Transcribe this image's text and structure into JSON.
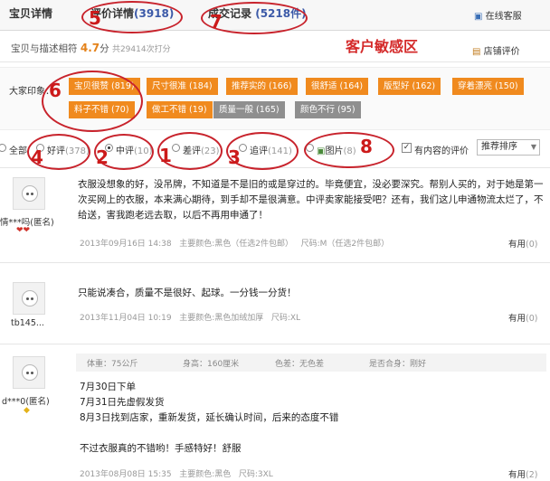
{
  "tabs": {
    "desc": "宝贝详情",
    "reviews_label": "评价详情",
    "reviews_count": "(3918)",
    "records_label": "成交记录",
    "records_count": "(5218件)",
    "service": "在线客服"
  },
  "rating": {
    "label": "宝贝与描述相符",
    "score": "4.7",
    "unit": "分",
    "total": "共29414次打分",
    "shop_rating": "店铺评价"
  },
  "sensitive_zone": "客户敏感区",
  "impressions": {
    "label": "大家印象：",
    "tags": [
      {
        "text": "宝贝很赞 (819)",
        "tone": "orange"
      },
      {
        "text": "尺寸很准 (184)",
        "tone": "orange"
      },
      {
        "text": "推荐实的 (166)",
        "tone": "orange"
      },
      {
        "text": "很舒适 (164)",
        "tone": "orange"
      },
      {
        "text": "版型好 (162)",
        "tone": "orange"
      },
      {
        "text": "穿着漂亮 (150)",
        "tone": "orange"
      },
      {
        "text": "料子不错 (70)",
        "tone": "orange"
      },
      {
        "text": "做工不错 (19)",
        "tone": "orange"
      },
      {
        "text": "质量一般 (165)",
        "tone": "gray"
      },
      {
        "text": "颜色不行 (95)",
        "tone": "gray"
      }
    ]
  },
  "filters": {
    "all": "全部",
    "good": "好评",
    "good_count": "(378)",
    "mid": "中评",
    "mid_count": "(10)",
    "bad": "差评",
    "bad_count": "(23)",
    "append": "追评",
    "append_count": "(141)",
    "pic": "图片",
    "pic_count": "(8)",
    "has_content": "有内容的评价",
    "sort": "推荐排序"
  },
  "annotations": {
    "a1": "1",
    "a2": "2",
    "a3": "3",
    "a4": "4",
    "a5": "5",
    "a6": "6",
    "a7": "7",
    "a8": "8"
  },
  "reviews": [
    {
      "user": "情***吗(匿名)",
      "text": "衣服没想象的好，没吊牌，不知道是不是旧的或是穿过的。毕竟便宜，没必要深究。帮别人买的，对于她是第一次买网上的衣服，本来满心期待，到手却不是很满意。中评卖家能接受吧？还有，我们这儿申通物流太烂了，不给送，害我跑老远去取，以后不再用申通了！",
      "date": "2013年09月16日 14:38",
      "color": "主要颜色:黑色（任选2件包邮）",
      "size": "尺码:M（任选2件包邮）",
      "useful": "有用",
      "useful_count": "(0)"
    },
    {
      "user": "tb145...",
      "text": "只能说凑合，质量不是很好、起球。一分钱一分货！",
      "date": "2013年11月04日 10:19",
      "color": "主要颜色:黑色加绒加厚",
      "size": "尺码:XL",
      "useful": "有用",
      "useful_count": "(0)"
    },
    {
      "user": "d***0(匿名)",
      "body": {
        "weight": "体重：75公斤",
        "height": "身高：160厘米",
        "color_diff": "色差：无色差",
        "fit": "是否合身：刚好"
      },
      "lines": [
        "7月30日下单",
        "7月31日先虚假发货",
        "8月3日找到店家，重新发货，延长确认时间，后来的态度不错",
        "",
        "不过衣服真的不错哟！手感特好！舒服"
      ],
      "date": "2013年08月08日 15:35",
      "color": "主要颜色:黑色",
      "size": "尺码:3XL",
      "useful": "有用",
      "useful_count": "(2)"
    }
  ]
}
